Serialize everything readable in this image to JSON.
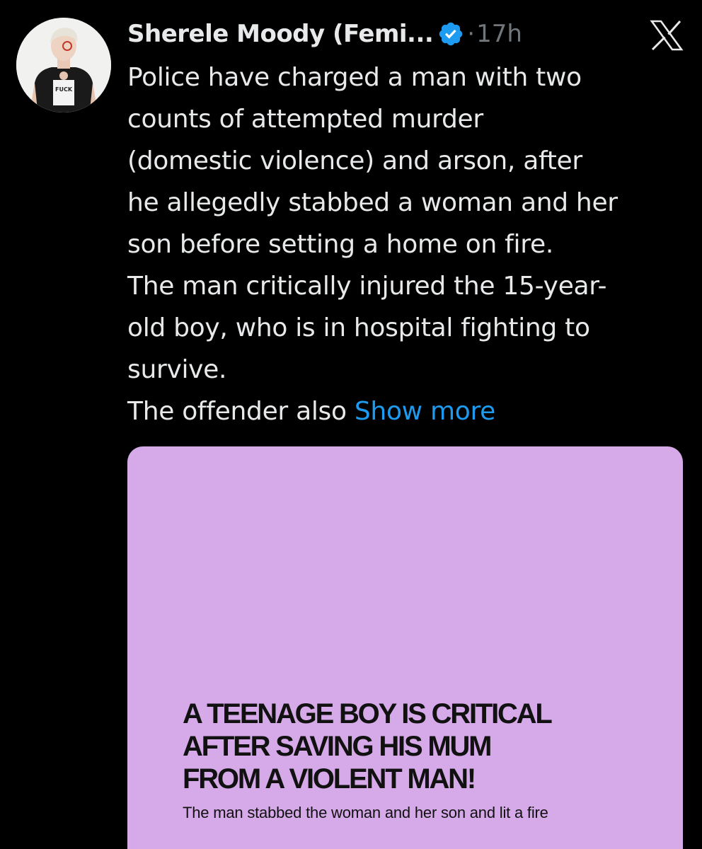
{
  "tweet": {
    "author_name": "Sherele Moody (Femi...",
    "verified_color": "#1d9bf0",
    "separator": "·",
    "time_ago": "17h",
    "platform_icon": "x-logo-icon",
    "text_lines": [
      "Police have charged a man with two",
      "counts of attempted murder",
      "(domestic violence) and arson, after",
      "he allegedly stabbed a woman and her",
      "son before setting a home on fire.",
      "The man critically injured the 15-year-",
      "old boy, who is in hospital fighting to",
      "survive."
    ],
    "last_line_text": "The offender also ",
    "show_more_label": "Show more",
    "show_more_color": "#1d9bf0"
  },
  "avatar": {
    "shirt_text": "FUCK"
  },
  "media": {
    "background_color": "#d6a9e8",
    "headline_lines": [
      "A TEENAGE BOY IS CRITICAL",
      "AFTER SAVING HIS MUM",
      "FROM A VIOLENT MAN!"
    ],
    "subheadline": "The man stabbed the woman and her son and lit a fire"
  }
}
